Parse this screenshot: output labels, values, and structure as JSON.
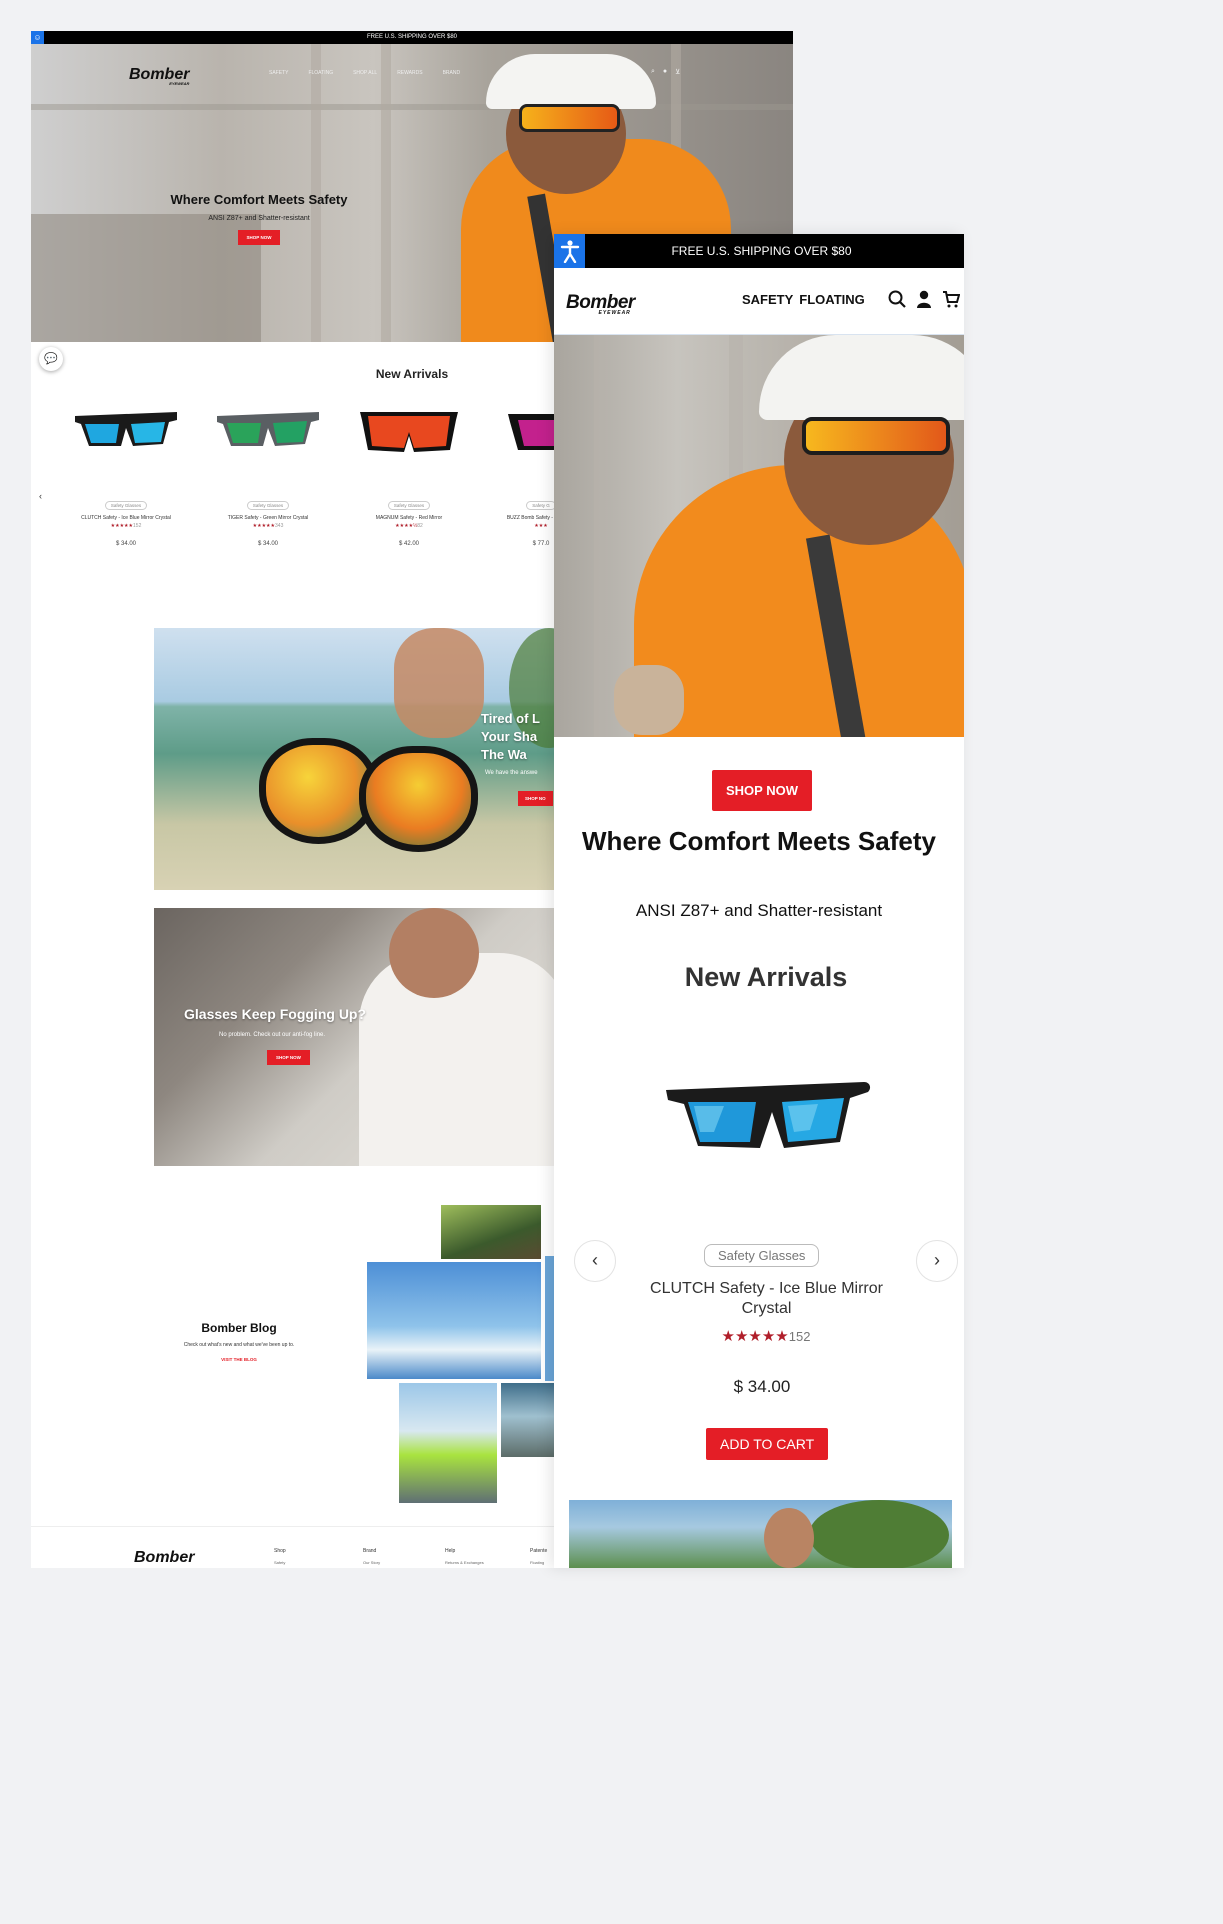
{
  "desktop": {
    "announcement": "FREE U.S. SHIPPING OVER $80",
    "logo": "Bomber",
    "logo_sub": "EYEWEAR",
    "nav": [
      "SAFETY",
      "FLOATING",
      "SHOP ALL",
      "REWARDS",
      "BRAND"
    ],
    "hero": {
      "title": "Where Comfort Meets Safety",
      "subtitle": "ANSI Z87+ and Shatter-resistant",
      "button": "SHOP NOW"
    },
    "new_arrivals": {
      "heading": "New Arrivals",
      "prev": "‹",
      "products": [
        {
          "tag": "Safety Glasses",
          "name": "CLUTCH Safety - Ice Blue Mirror Crystal",
          "stars": "★★★★★",
          "reviews": "152",
          "price": "$ 34.00"
        },
        {
          "tag": "Safety Glasses",
          "name": "TIGER Safety - Green Mirror Crystal",
          "stars": "★★★★★",
          "reviews": "343",
          "price": "$ 34.00"
        },
        {
          "tag": "Safety Glasses",
          "name": "MAGNUM Safety - Red Mirror",
          "stars": "★★★★½",
          "reviews": "82",
          "price": "$ 42.00"
        },
        {
          "tag": "Safety G",
          "name": "BUZZ Bomb Safety - I Mirror C",
          "stars": "★★★",
          "reviews": "",
          "price": "$ 77.0"
        }
      ]
    },
    "banner1": {
      "line1": "Tired of L",
      "line2": "Your Sha",
      "line3": "The Wa",
      "subtitle": "We have the answe",
      "button": "SHOP NO"
    },
    "banner2": {
      "title": "Glasses Keep Fogging Up?",
      "subtitle": "No problem. Check out our anti-fog line.",
      "button": "SHOP NOW"
    },
    "blog": {
      "title": "Bomber Blog",
      "subtitle": "Check out what's new and what we've been up to.",
      "link": "VISIT THE BLOG"
    },
    "footer": {
      "logo": "Bomber",
      "columns": [
        {
          "title": "Shop",
          "item": "Safety"
        },
        {
          "title": "Brand",
          "item": "Our Story"
        },
        {
          "title": "Help",
          "item": "Returns & Exchanges"
        },
        {
          "title": "Patente",
          "item": "Floating"
        }
      ]
    }
  },
  "mobile": {
    "announcement": "FREE U.S. SHIPPING OVER $80",
    "logo": "Bomber",
    "logo_sub": "EYEWEAR",
    "nav": [
      "SAFETY",
      "FLOATING"
    ],
    "hero": {
      "button": "SHOP NOW",
      "title": "Where Comfort Meets Safety",
      "subtitle": "ANSI Z87+ and Shatter-resistant"
    },
    "new_arrivals": {
      "heading": "New Arrivals",
      "prev": "‹",
      "next": "›",
      "product": {
        "tag": "Safety Glasses",
        "name": "CLUTCH Safety - Ice Blue Mirror Crystal",
        "stars": "★★★★★",
        "reviews": "152",
        "price": "$ 34.00",
        "button": "ADD TO CART"
      }
    }
  },
  "colors": {
    "brand_red": "#e41e26",
    "star_red": "#b01e2a",
    "accessibility_blue": "#1a73e8"
  }
}
